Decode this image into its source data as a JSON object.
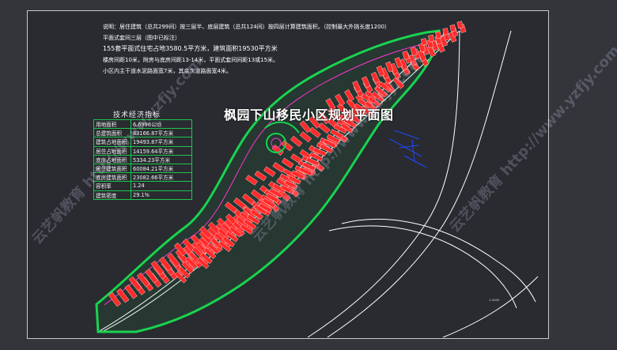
{
  "title": "枫园下山移民小区规划平面图",
  "notes": [
    "说明：居住建筑（总共299间）按三层半、底层建筑（总共124间）按四层计算建筑面积。（控制最大外挑长度1200）",
    "平面式套间三层（图中已标注）",
    "155套平面式住宅占地3580.5平方米，建筑面积19530平方米",
    "楼房间距10米，附房与底房间距13-14米，平面式套间间距13或15米。",
    "小区内主干道水泥路面宽7米，其余次道路面宽4米。"
  ],
  "table": {
    "title": "技术经济指标",
    "rows": [
      {
        "label": "用地面积",
        "value": "6.6996公顷"
      },
      {
        "label": "总建筑面积",
        "value": "83166.87平方米"
      },
      {
        "label": "建筑占地面积",
        "value": "19493.87平方米"
      },
      {
        "label": "居住占地面积",
        "value": "14159.64平方米"
      },
      {
        "label": "底房占地面积",
        "value": "5334.23平方米"
      },
      {
        "label": "居住建筑面积",
        "value": "60084.21平方米"
      },
      {
        "label": "底房建筑面积",
        "value": "23082.66平方米"
      },
      {
        "label": "容积率",
        "value": "1.24"
      },
      {
        "label": "建筑密度",
        "value": "29.1%"
      }
    ]
  },
  "watermark": "云艺帆教育 http://www.yzfjy.com",
  "scale_label": "1:1000",
  "colors": {
    "background": "#33353b",
    "panel": "#292b30",
    "road": "#ffffff",
    "site_line": "#19d34f",
    "building": "#ff2b2b",
    "magenta": "#d32bd3",
    "blue": "#2147ff"
  }
}
